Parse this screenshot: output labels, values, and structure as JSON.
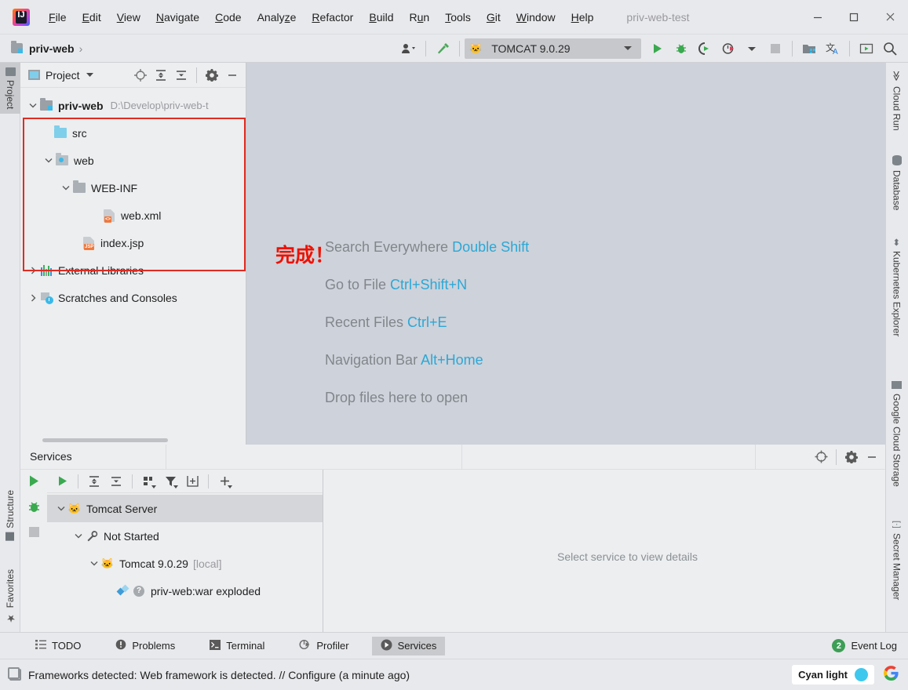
{
  "window": {
    "title": "priv-web-test",
    "minimize": "minimize-icon",
    "maximize": "maximize-icon",
    "close": "close-icon"
  },
  "menubar": {
    "items": [
      {
        "label": "File",
        "mnemonic": "F"
      },
      {
        "label": "Edit",
        "mnemonic": "E"
      },
      {
        "label": "View",
        "mnemonic": "V"
      },
      {
        "label": "Navigate",
        "mnemonic": "N"
      },
      {
        "label": "Code",
        "mnemonic": "C"
      },
      {
        "label": "Analyze",
        "mnemonic": "z"
      },
      {
        "label": "Refactor",
        "mnemonic": "R"
      },
      {
        "label": "Build",
        "mnemonic": "B"
      },
      {
        "label": "Run",
        "mnemonic": "u"
      },
      {
        "label": "Tools",
        "mnemonic": "T"
      },
      {
        "label": "Git",
        "mnemonic": "G"
      },
      {
        "label": "Window",
        "mnemonic": "W"
      },
      {
        "label": "Help",
        "mnemonic": "H"
      }
    ]
  },
  "navbar": {
    "breadcrumb": "priv-web",
    "separator": "›",
    "run_config": "TOMCAT 9.0.29",
    "icons": [
      "user-dropdown-icon",
      "hammer-build-icon",
      "run-icon",
      "debug-icon",
      "run-with-coverage-icon",
      "profile-icon",
      "stop-icon",
      "project-structure-icon",
      "translate-icon",
      "preview-icon",
      "search-icon"
    ]
  },
  "left_stripe": {
    "tabs": [
      {
        "label": "Project",
        "icon": "project-folder-icon",
        "active": true
      },
      {
        "label": "Structure",
        "icon": "structure-icon",
        "active": false
      },
      {
        "label": "Favorites",
        "icon": "star-icon",
        "active": false
      }
    ]
  },
  "right_stripe": {
    "tabs": [
      {
        "label": "Cloud Run",
        "icon": "cloud-run-icon"
      },
      {
        "label": "Database",
        "icon": "database-icon"
      },
      {
        "label": "Kubernetes Explorer",
        "icon": "kubernetes-icon"
      },
      {
        "label": "Google Cloud Storage",
        "icon": "storage-icon"
      },
      {
        "label": "Secret Manager",
        "icon": "secret-manager-icon"
      }
    ]
  },
  "project_panel": {
    "title": "Project",
    "toolbar_icons": [
      "locate-icon",
      "expand-all-icon",
      "collapse-all-icon",
      "gear-icon",
      "minimize-icon"
    ],
    "tree": [
      {
        "label": "priv-web",
        "path": "D:\\Develop\\priv-web-t",
        "icon": "module-folder-icon",
        "chevron": "⌄",
        "indent": 0,
        "bold": true
      },
      {
        "label": "src",
        "path": "",
        "icon": "source-folder-icon",
        "chevron": "",
        "indent": 1,
        "bold": false
      },
      {
        "label": "web",
        "path": "",
        "icon": "web-root-folder-icon",
        "chevron": "⌄",
        "indent": 1,
        "bold": false
      },
      {
        "label": "WEB-INF",
        "path": "",
        "icon": "folder-icon",
        "chevron": "⌄",
        "indent": 2,
        "bold": false
      },
      {
        "label": "web.xml",
        "path": "",
        "icon": "xml-file-icon",
        "chevron": "",
        "indent": 3,
        "bold": false
      },
      {
        "label": "index.jsp",
        "path": "",
        "icon": "jsp-file-icon",
        "chevron": "",
        "indent": 2,
        "bold": false
      },
      {
        "label": "External Libraries",
        "path": "",
        "icon": "libraries-icon",
        "chevron": "›",
        "indent": 0,
        "bold": false
      },
      {
        "label": "Scratches and Consoles",
        "path": "",
        "icon": "scratches-icon",
        "chevron": "›",
        "indent": 0,
        "bold": false
      }
    ],
    "highlight_color": "#e02b20"
  },
  "editor": {
    "annotation": "完成！",
    "annotation_color": "#ee1100",
    "hints": [
      {
        "text": "Search Everywhere ",
        "key": "Double Shift"
      },
      {
        "text": "Go to File ",
        "key": "Ctrl+Shift+N"
      },
      {
        "text": "Recent Files ",
        "key": "Ctrl+E"
      },
      {
        "text": "Navigation Bar ",
        "key": "Alt+Home"
      },
      {
        "text": "Drop files here to open",
        "key": ""
      }
    ],
    "key_color": "#2ba8d6"
  },
  "services": {
    "tab_title": "Services",
    "header_icons": [
      "locate-icon",
      "gear-icon",
      "minimize-icon"
    ],
    "gutter_icons": [
      "run-icon",
      "debug-icon",
      "stop-icon"
    ],
    "toolbar_icons": [
      "run-icon",
      "expand-all-icon",
      "collapse-all-icon",
      "group-by-icon",
      "filter-icon",
      "add-tab-icon",
      "add-icon"
    ],
    "tree": [
      {
        "label": "Tomcat Server",
        "suffix": "",
        "icon": "tomcat-icon",
        "chevron": "⌄",
        "indent": 0,
        "selected": true
      },
      {
        "label": "Not Started",
        "suffix": "",
        "icon": "wrench-icon",
        "chevron": "⌄",
        "indent": 1,
        "selected": false
      },
      {
        "label": "Tomcat 9.0.29",
        "suffix": "[local]",
        "icon": "tomcat-icon",
        "chevron": "⌄",
        "indent": 2,
        "selected": false
      },
      {
        "label": "priv-web:war exploded",
        "suffix": "",
        "icon": "artifact-icon",
        "chevron": "",
        "indent": 3,
        "selected": false
      }
    ],
    "placeholder": "Select service to view details"
  },
  "bottom_bar": {
    "tabs": [
      {
        "label": "TODO",
        "icon": "todo-icon",
        "active": false
      },
      {
        "label": "Problems",
        "icon": "problems-icon",
        "active": false
      },
      {
        "label": "Terminal",
        "icon": "terminal-icon",
        "active": false
      },
      {
        "label": "Profiler",
        "icon": "profiler-icon",
        "active": false
      },
      {
        "label": "Services",
        "icon": "services-icon",
        "active": true
      }
    ],
    "event_log": {
      "label": "Event Log",
      "count": "2"
    }
  },
  "status_bar": {
    "message": "Frameworks detected: Web framework is detected. // Configure (a minute ago)",
    "theme": {
      "label": "Cyan light",
      "color": "#3ec8ee"
    },
    "google_icon": "google-icon"
  }
}
